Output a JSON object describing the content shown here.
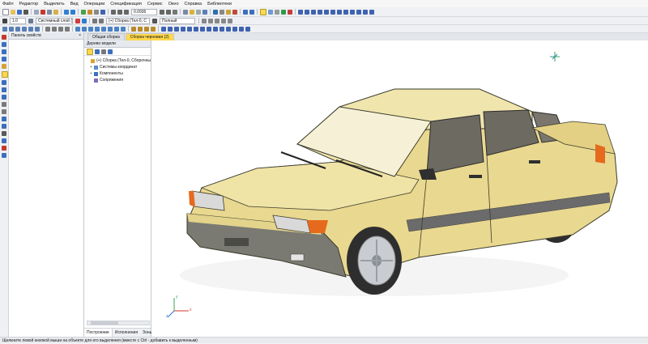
{
  "menu": [
    "Файл",
    "Редактор",
    "Выделить",
    "Вид",
    "Операции",
    "Спецификация",
    "Сервис",
    "Окно",
    "Справка",
    "Библиотеки"
  ],
  "toolbar1": {
    "zoom_value": "0.0936"
  },
  "toolbar2": {
    "line_width": "1.0",
    "layer": "Системный слой (0)",
    "object": "(+) Сборка (Тел-0, С",
    "mode": "Полный"
  },
  "properties_panel": {
    "title": "Панель свойств",
    "close": "×"
  },
  "model_tree": {
    "title": "Дерево модели",
    "root": {
      "toggle": "",
      "label": "(+) Сборка (Тел-0, Сборочны"
    },
    "children": [
      {
        "toggle": "+",
        "label": "Системы координат"
      },
      {
        "toggle": "+",
        "label": "Компоненты"
      },
      {
        "toggle": "",
        "label": "Сопряжения"
      }
    ],
    "bottom_tabs": [
      "Построение",
      "Исполнения",
      "Зоны"
    ]
  },
  "doc_tabs": [
    {
      "label": "Общая сборка",
      "active": false
    },
    {
      "label": "Сборка черновая (2)",
      "active": true
    }
  ],
  "axes": {
    "x": "x",
    "y": "y",
    "z": "z"
  },
  "status_text": "Щелкните левой кнопкой мыши на объекте для его выделения (вместе с Ctrl - добавить к выделенным)",
  "colors": {
    "car_body": "#e9d88f",
    "car_shade": "#c9b46a",
    "accent_tab": "#ffd84d",
    "trim": "#6b6b6b"
  }
}
